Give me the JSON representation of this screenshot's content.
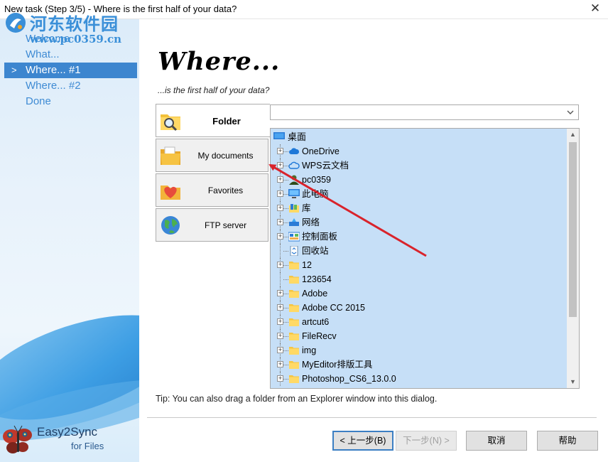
{
  "window": {
    "title": "New task (Step 3/5) - Where is the first half of your data?",
    "close_glyph": "✕"
  },
  "wizard_steps": [
    {
      "label": "Welcome",
      "active": false
    },
    {
      "label": "What...",
      "active": false
    },
    {
      "label": "Where... #1",
      "active": true
    },
    {
      "label": "Where... #2",
      "active": false
    },
    {
      "label": "Done",
      "active": false
    }
  ],
  "active_marker": ">",
  "watermark": {
    "name": "河东软件园",
    "url": "www.pc0359.cn"
  },
  "branding": {
    "line1": "Easy2Sync",
    "line2": "for Files"
  },
  "page": {
    "heading": "Where...",
    "subheading": "...is the first half of your data?"
  },
  "sources": [
    {
      "label": "Folder",
      "icon": "folder-search-icon",
      "selected": true
    },
    {
      "label": "My documents",
      "icon": "documents-folder-icon",
      "selected": false
    },
    {
      "label": "Favorites",
      "icon": "heart-folder-icon",
      "selected": false
    },
    {
      "label": "FTP server",
      "icon": "globe-icon",
      "selected": false
    }
  ],
  "path_combo": {
    "value": ""
  },
  "tree": {
    "root": {
      "label": "桌面",
      "icon": "desktop-icon"
    },
    "items": [
      {
        "label": "OneDrive",
        "icon": "cloud-icon",
        "expandable": true
      },
      {
        "label": "WPS云文档",
        "icon": "cloud-outline-icon",
        "expandable": true
      },
      {
        "label": "pc0359",
        "icon": "user-icon",
        "expandable": true
      },
      {
        "label": "此电脑",
        "icon": "computer-icon",
        "expandable": true
      },
      {
        "label": "库",
        "icon": "library-icon",
        "expandable": true
      },
      {
        "label": "网络",
        "icon": "network-icon",
        "expandable": true
      },
      {
        "label": "控制面板",
        "icon": "control-panel-icon",
        "expandable": true
      },
      {
        "label": "回收站",
        "icon": "recycle-bin-icon",
        "expandable": false
      },
      {
        "label": "12",
        "icon": "folder-icon",
        "expandable": true
      },
      {
        "label": "123654",
        "icon": "folder-icon",
        "expandable": false
      },
      {
        "label": "Adobe",
        "icon": "folder-icon",
        "expandable": true
      },
      {
        "label": "Adobe CC 2015",
        "icon": "folder-icon",
        "expandable": true
      },
      {
        "label": "artcut6",
        "icon": "folder-icon",
        "expandable": true
      },
      {
        "label": "FileRecv",
        "icon": "folder-icon",
        "expandable": true
      },
      {
        "label": "img",
        "icon": "folder-icon",
        "expandable": true
      },
      {
        "label": "MyEditor排版工具",
        "icon": "folder-icon",
        "expandable": true
      },
      {
        "label": "Photoshop_CS6_13.0.0",
        "icon": "folder-icon",
        "expandable": true
      }
    ]
  },
  "tip": "Tip: You can also drag a folder from an Explorer window into this dialog.",
  "buttons": {
    "back": "< 上一步(B)",
    "next": "下一步(N) >",
    "cancel": "取消",
    "help": "帮助"
  },
  "colors": {
    "accent": "#3d86cf",
    "step_text": "#3f8bd4",
    "tree_bg": "#c6dff7",
    "annotation_arrow": "#d9232b"
  }
}
